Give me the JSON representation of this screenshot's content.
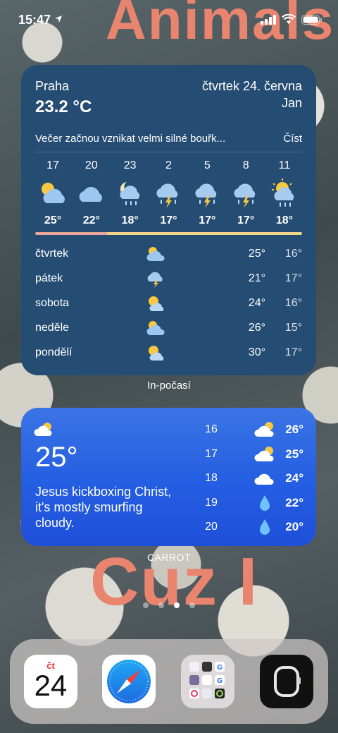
{
  "status": {
    "time": "15:47"
  },
  "wallpaper": {
    "top_text": "Animals",
    "bottom_text": "Cuz I"
  },
  "weather_widget": {
    "city": "Praha",
    "temp": "23.2 °C",
    "date": "čtvrtek 24. června",
    "name": "Jan",
    "summary": "Večer začnou vznikat velmi silné bouřk...",
    "read_label": "Číst",
    "hourly": [
      {
        "hour": "17",
        "icon": "cloud-sun-icon",
        "temp": "25°"
      },
      {
        "hour": "20",
        "icon": "cloud-icon",
        "temp": "22°"
      },
      {
        "hour": "23",
        "icon": "cloud-moon-rain-icon",
        "temp": "18°"
      },
      {
        "hour": "2",
        "icon": "thunderstorm-icon",
        "temp": "17°"
      },
      {
        "hour": "5",
        "icon": "thunderstorm-icon",
        "temp": "17°"
      },
      {
        "hour": "8",
        "icon": "thunderstorm-icon",
        "temp": "17°"
      },
      {
        "hour": "11",
        "icon": "sun-rain-icon",
        "temp": "18°"
      }
    ],
    "daily": [
      {
        "day": "čtvrtek",
        "icon": "cloud-sun-icon",
        "high": "25°",
        "low": "16°"
      },
      {
        "day": "pátek",
        "icon": "thunderstorm-icon",
        "high": "21°",
        "low": "17°"
      },
      {
        "day": "sobota",
        "icon": "sun-cloud-icon",
        "high": "24°",
        "low": "16°"
      },
      {
        "day": "neděle",
        "icon": "cloud-sun-icon",
        "high": "26°",
        "low": "15°"
      },
      {
        "day": "pondělí",
        "icon": "sun-cloud-icon",
        "high": "30°",
        "low": "17°"
      }
    ],
    "label": "In-počasí"
  },
  "carrot_widget": {
    "current_icon": "cloud-sun-icon",
    "temp": "25°",
    "quote": "Jesus kickboxing Christ, it's mostly smurfing cloudy.",
    "hourly": [
      {
        "hour": "16",
        "icon": "cloud-sun-icon",
        "temp": "26°"
      },
      {
        "hour": "17",
        "icon": "cloud-sun-icon",
        "temp": "25°"
      },
      {
        "hour": "18",
        "icon": "cloud-icon",
        "temp": "24°"
      },
      {
        "hour": "19",
        "icon": "raindrop-icon",
        "temp": "22°"
      },
      {
        "hour": "20",
        "icon": "raindrop-icon",
        "temp": "20°"
      }
    ],
    "label": "CARROT"
  },
  "page_dots": {
    "count": 4,
    "active": 3
  },
  "dock": {
    "calendar": {
      "weekday": "čt",
      "day": "24"
    },
    "apps": [
      "calendar-app",
      "safari-app",
      "app-folder",
      "watch-app"
    ]
  }
}
